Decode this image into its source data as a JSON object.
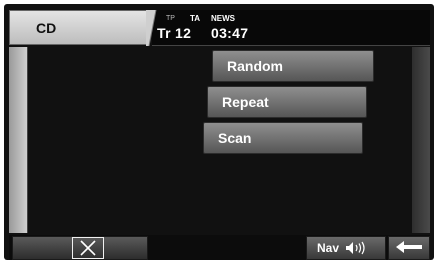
{
  "header": {
    "source_label": "CD",
    "tp": "TP",
    "ta": "TA",
    "news": "NEWS",
    "track": "Tr 12",
    "time": "03:47"
  },
  "menu": {
    "items": [
      {
        "label": "Random"
      },
      {
        "label": "Repeat"
      },
      {
        "label": "Scan"
      }
    ]
  },
  "footer": {
    "close_icon": "close-icon",
    "nav_label": "Nav",
    "volume_icon": "speaker-volume-icon",
    "back_icon": "back-arrow-icon"
  }
}
